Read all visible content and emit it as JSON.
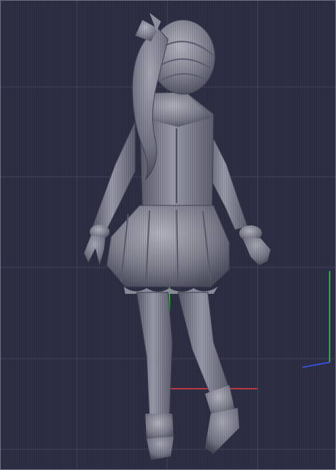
{
  "viewport": {
    "background": "#2d2f45",
    "grid_line_color": "#41445c",
    "model_material": "matcap-gray",
    "model_colors": {
      "base": "#7f808e",
      "light": "#b3b4c0",
      "shadow": "#4d4e5e"
    },
    "axis_colors": {
      "x": "#c23a44",
      "y": "#37b04a",
      "z": "#3a52d8"
    }
  }
}
